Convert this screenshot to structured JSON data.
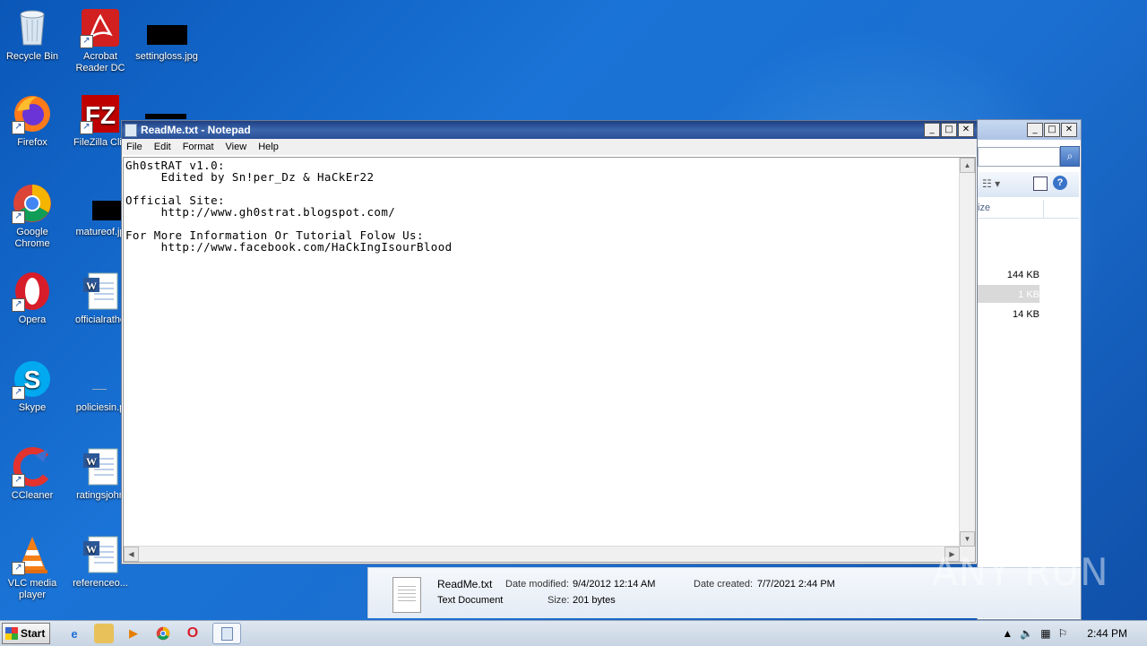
{
  "desktop": {
    "icons": [
      {
        "label": "Recycle Bin",
        "icon": "recycle-bin-icon"
      },
      {
        "label": "Acrobat Reader DC",
        "icon": "acrobat-icon"
      },
      {
        "label": "settingloss.jpg",
        "icon": "image-file-icon"
      },
      {
        "label": "Firefox",
        "icon": "firefox-icon"
      },
      {
        "label": "FileZilla Clie",
        "icon": "filezilla-icon"
      },
      {
        "label": "Google Chrome",
        "icon": "chrome-icon"
      },
      {
        "label": "matureof.jp",
        "icon": "image-file-icon"
      },
      {
        "label": "Opera",
        "icon": "opera-icon"
      },
      {
        "label": "officialrathe",
        "icon": "word-doc-icon"
      },
      {
        "label": "Skype",
        "icon": "skype-icon"
      },
      {
        "label": "policiesin.p",
        "icon": "file-icon"
      },
      {
        "label": "CCleaner",
        "icon": "ccleaner-icon"
      },
      {
        "label": "ratingsjohn",
        "icon": "word-doc-icon"
      },
      {
        "label": "VLC media player",
        "icon": "vlc-icon"
      },
      {
        "label": "referenceo...",
        "icon": "word-doc-icon"
      }
    ]
  },
  "notepad": {
    "title": "ReadMe.txt - Notepad",
    "menu": [
      "File",
      "Edit",
      "Format",
      "View",
      "Help"
    ],
    "content": "Gh0stRAT v1.0:\n     Edited by Sn!per_Dz & HaCkEr22\n\nOfficial Site:\n     http://www.gh0strat.blogspot.com/\n\nFor More Information Or Tutorial Folow Us:\n     http://www.facebook.com/HaCkIngIsourBlood"
  },
  "explorer": {
    "column_header": "ize",
    "sizes": [
      "144 KB",
      "1 KB",
      "14 KB"
    ]
  },
  "details_pane": {
    "filename": "ReadMe.txt",
    "type": "Text Document",
    "date_modified_label": "Date modified:",
    "date_modified": "9/4/2012 12:14 AM",
    "date_created_label": "Date created:",
    "date_created": "7/7/2021 2:44 PM",
    "size_label": "Size:",
    "size": "201 bytes"
  },
  "taskbar": {
    "start_label": "Start",
    "clock": "2:44 PM"
  },
  "watermark": "ANY RUN"
}
